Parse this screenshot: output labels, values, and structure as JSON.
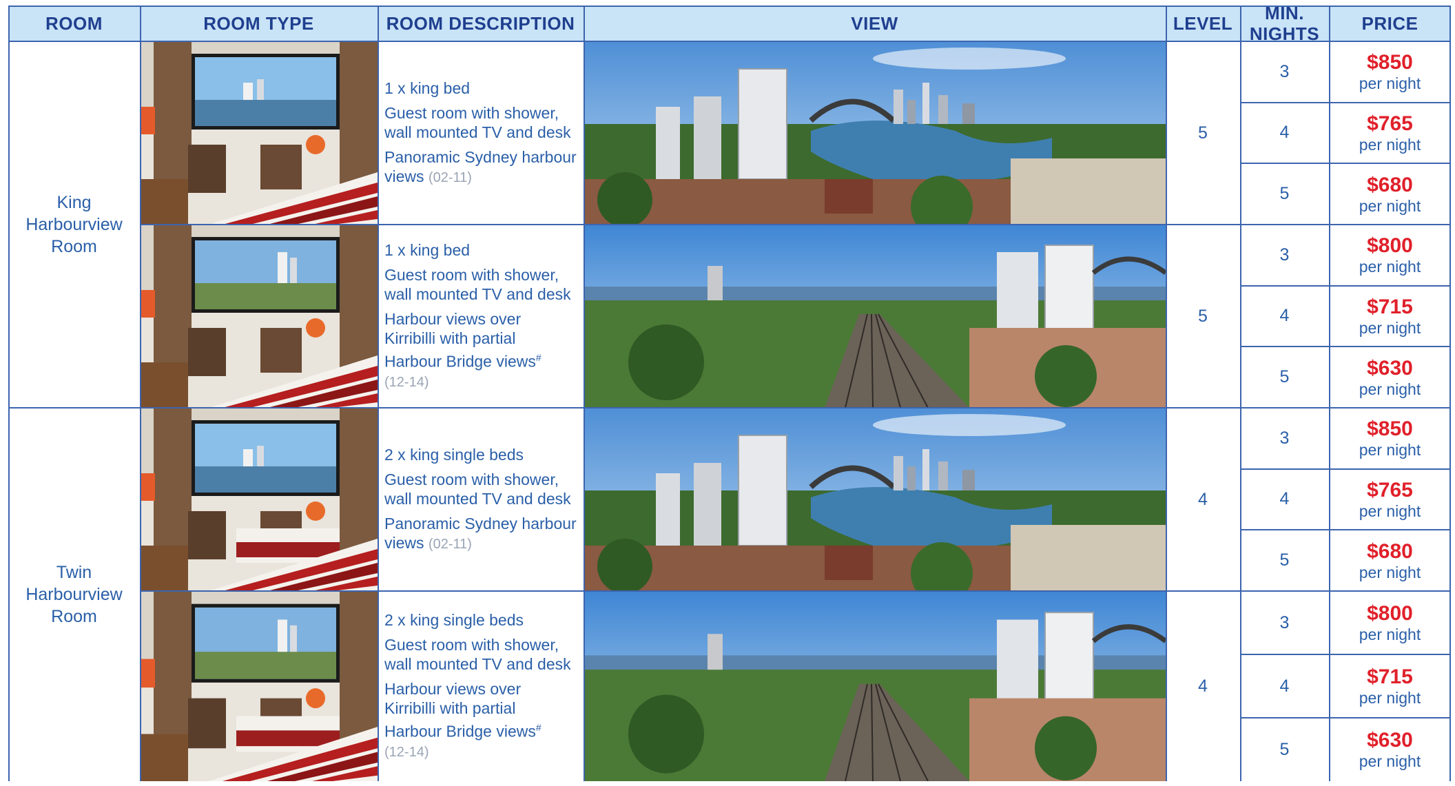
{
  "headers": {
    "room": "ROOM",
    "room_type": "ROOM TYPE",
    "room_description": "ROOM DESCRIPTION",
    "view": "VIEW",
    "level": "LEVEL",
    "min_nights_1": "MIN.",
    "min_nights_2": "NIGHTS",
    "price": "PRICE"
  },
  "rooms": [
    {
      "name_lines": [
        "King",
        "Harbourview",
        "Room"
      ]
    },
    {
      "name_lines": [
        "Twin",
        "Harbourview",
        "Room"
      ]
    }
  ],
  "rows": [
    {
      "bed": "1 x king bed",
      "features": [
        "Guest room with shower,",
        "wall mounted TV and desk"
      ],
      "view_lines": [
        "Panoramic Sydney harbour",
        "views"
      ],
      "code": "(02-11)",
      "level": "5",
      "prices": [
        {
          "nights": "3",
          "amount": "$850",
          "per": "per night"
        },
        {
          "nights": "4",
          "amount": "$765",
          "per": "per night"
        },
        {
          "nights": "5",
          "amount": "$680",
          "per": "per night"
        }
      ]
    },
    {
      "bed": "1 x king bed",
      "features": [
        "Guest room with shower,",
        "wall mounted TV and desk"
      ],
      "view_lines": [
        "Harbour views over",
        "Kirribilli with partial",
        "Harbour Bridge views"
      ],
      "hash": "#",
      "code": "(12-14)",
      "level": "5",
      "prices": [
        {
          "nights": "3",
          "amount": "$800",
          "per": "per night"
        },
        {
          "nights": "4",
          "amount": "$715",
          "per": "per night"
        },
        {
          "nights": "5",
          "amount": "$630",
          "per": "per night"
        }
      ]
    },
    {
      "bed": "2 x king single beds",
      "features": [
        "Guest room with shower,",
        "wall mounted TV and desk"
      ],
      "view_lines": [
        "Panoramic Sydney harbour",
        "views"
      ],
      "code": "(02-11)",
      "level": "4",
      "prices": [
        {
          "nights": "3",
          "amount": "$850",
          "per": "per night"
        },
        {
          "nights": "4",
          "amount": "$765",
          "per": "per night"
        },
        {
          "nights": "5",
          "amount": "$680",
          "per": "per night"
        }
      ]
    },
    {
      "bed": "2 x king single beds",
      "features": [
        "Guest room with shower,",
        "wall mounted TV and desk"
      ],
      "view_lines": [
        "Harbour views over",
        "Kirribilli with partial",
        "Harbour Bridge views"
      ],
      "hash": "#",
      "code": "(12-14)",
      "level": "4",
      "prices": [
        {
          "nights": "3",
          "amount": "$800",
          "per": "per night"
        },
        {
          "nights": "4",
          "amount": "$715",
          "per": "per night"
        },
        {
          "nights": "5",
          "amount": "$630",
          "per": "per night"
        }
      ]
    }
  ],
  "colors": {
    "header_bg": "#c9e3f7",
    "header_text": "#1f3f8f",
    "body_text": "#2a5fa8",
    "price_text": "#e0202a",
    "border": "#3c64ae"
  }
}
